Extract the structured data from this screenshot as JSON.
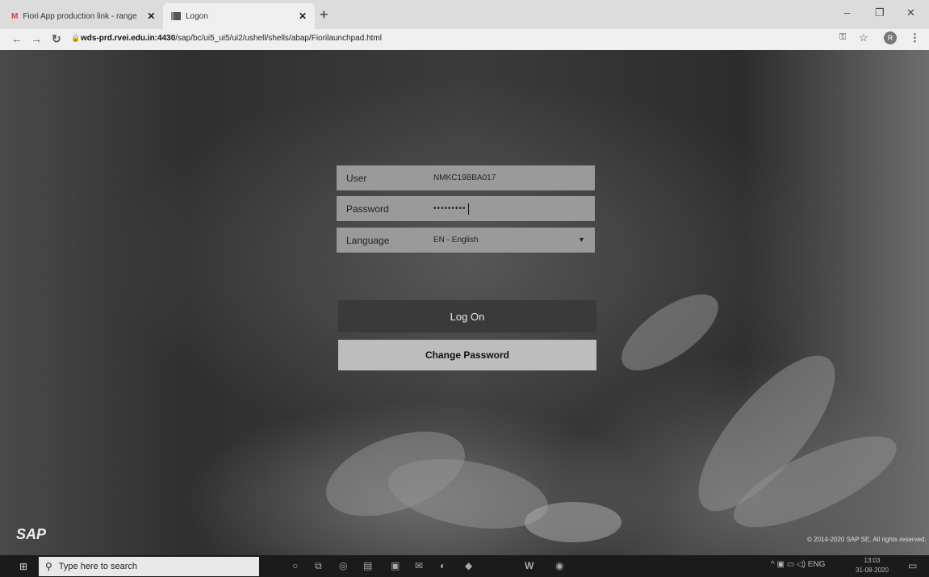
{
  "browser": {
    "tabs": [
      {
        "icon": "M",
        "title": "Fiori App production link - range",
        "close": "✕"
      },
      {
        "title": "Logon",
        "close": "✕"
      }
    ],
    "new_tab": "+",
    "window": {
      "minimize": "–",
      "maximize": "❐",
      "close": "✕"
    },
    "url_domain": "wds-prd.rvei.edu.in:4430",
    "url_path": "/sap/bc/ui5_ui5/ui2/ushell/shells/abap/Fiorilaunchpad.html",
    "profile_initial": "R"
  },
  "login": {
    "user_label": "User",
    "user_value": "NMKC19BBA017",
    "password_label": "Password",
    "password_value": "•••••••••",
    "language_label": "Language",
    "language_value": "EN - English",
    "logon_button": "Log On",
    "change_password_button": "Change Password"
  },
  "footer": {
    "logo": "SAP",
    "copyright": "© 2014-2020 SAP SE. All rights reserved."
  },
  "taskbar": {
    "search_placeholder": "Type here to search",
    "tray_lang": "ENG",
    "time": "13:03",
    "date": "31-08-2020"
  },
  "colors": {
    "page_bg": "#333333",
    "field_bg": "#9a9a9a",
    "logon_bg": "#3a3a3a",
    "change_pw_bg": "#bdbdbd",
    "taskbar_bg": "#1b1b1b"
  }
}
